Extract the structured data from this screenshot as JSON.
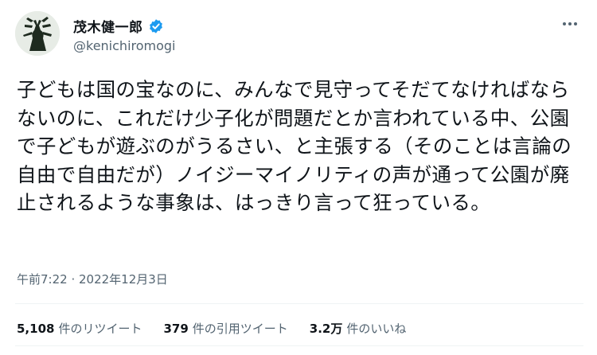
{
  "author": {
    "name": "茂木健一郎",
    "handle": "@kenichiromogi"
  },
  "tweet": {
    "text": "子どもは国の宝なのに、みんなで見守ってそだてなければならないのに、これだけ少子化が問題だとか言われている中、公園で子どもが遊ぶのがうるさい、と主張する（そのことは言論の自由で自由だが）ノイジーマイノリティの声が通って公園が廃止されるような事象は、はっきり言って狂っている。",
    "timestamp": "午前7:22 · 2022年12月3日"
  },
  "stats": [
    {
      "value": "5,108",
      "label": "件のリツイート"
    },
    {
      "value": "379",
      "label": "件の引用ツイート"
    },
    {
      "value": "3.2万",
      "label": "件のいいね"
    }
  ],
  "colors": {
    "verified": "#1d9bf0",
    "text": "#0f1419",
    "secondary": "#536471",
    "avatar_bg": "#e7ece6"
  }
}
